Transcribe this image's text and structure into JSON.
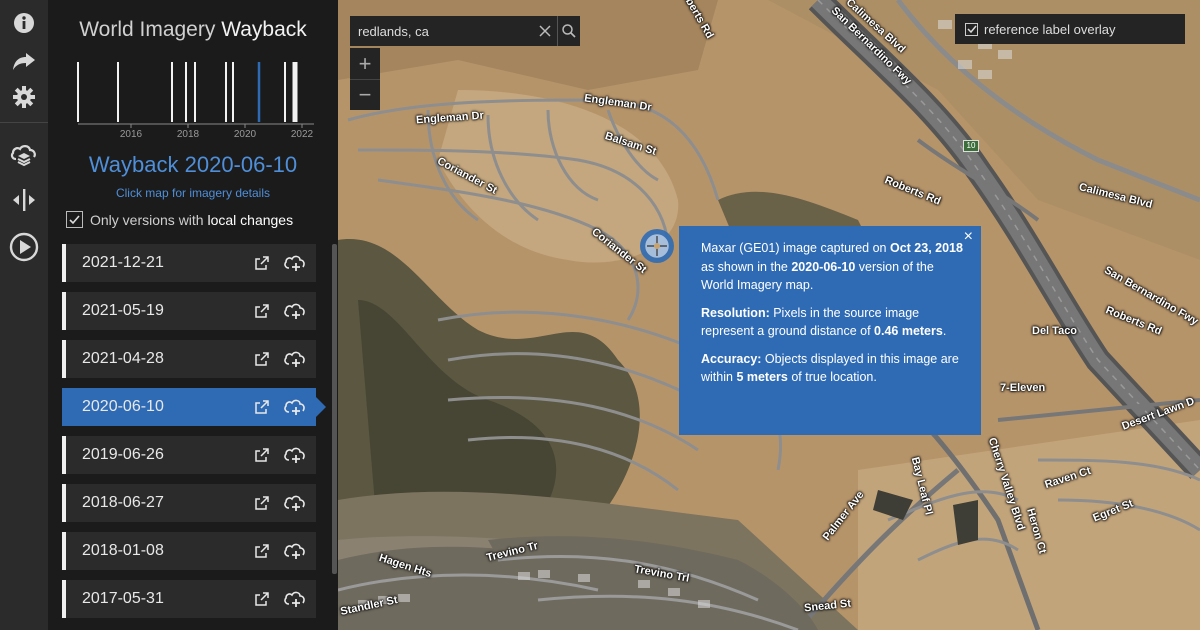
{
  "rail": {
    "icons": [
      "info-icon",
      "share-icon",
      "settings-icon",
      "layers-sync-icon",
      "swipe-icon",
      "play-icon"
    ]
  },
  "panel": {
    "title_plain": "World Imagery ",
    "title_bold": "Wayback",
    "timeline": {
      "tick_labels": [
        "2016",
        "2018",
        "2020",
        "2022"
      ],
      "selected_release": "2020-06-10"
    },
    "wayback_label": "Wayback 2020-06-10",
    "click_hint": "Click map for imagery details",
    "local_changes": {
      "checked": true,
      "label_plain": "Only versions with ",
      "label_bold": "local changes"
    },
    "releases": [
      {
        "date": "2021-12-21",
        "active": false
      },
      {
        "date": "2021-05-19",
        "active": false
      },
      {
        "date": "2021-04-28",
        "active": false
      },
      {
        "date": "2020-06-10",
        "active": true
      },
      {
        "date": "2019-06-26",
        "active": false
      },
      {
        "date": "2018-06-27",
        "active": false
      },
      {
        "date": "2018-01-08",
        "active": false
      },
      {
        "date": "2017-05-31",
        "active": false
      }
    ],
    "accent_color": "#2f6bb5"
  },
  "map": {
    "search": {
      "value": "redlands, ca",
      "clear_icon": "close-icon",
      "search_icon": "search-icon"
    },
    "zoom": {
      "in": "+",
      "out": "−"
    },
    "label_overlay": {
      "checked": true,
      "label": "reference label overlay"
    },
    "road_labels": {
      "engleman_dr_1": "Engleman Dr",
      "engleman_dr_2": "Engleman Dr",
      "balsam_st": "Balsam St",
      "coriander_st_1": "Coriander St",
      "coriander_st_2": "Coriander St",
      "calimesa_blvd_1": "Calimesa Blvd",
      "calimesa_blvd_2": "Calimesa Blvd",
      "san_bernardino_fwy_1": "San Bernardino Fwy",
      "san_bernardino_fwy_2": "San Bernardino Fwy",
      "roberts_rd_1": "Roberts Rd",
      "roberts_rd_2": "Roberts Rd",
      "roberts_rd_3": "Roberts Rd",
      "del_taco": "Del Taco",
      "seven_eleven": "7-Eleven",
      "desert_lawn": "Desert Lawn D",
      "cherry_valley": "Cherry Valley Blvd",
      "raven_ct": "Raven Ct",
      "egret_st": "Egret St",
      "heron_ct": "Heron Ct",
      "bay_leaf_pl": "Bay Leaf Pl",
      "palmer_ave": "Palmer Ave",
      "hagen_hts": "Hagen Hts",
      "trevino_tr": "Trevino Tr",
      "trevino_trl": "Trevino Trl",
      "snead_st": "Snead St",
      "chandler_st": "Standler St",
      "shield": "10"
    },
    "popup": {
      "line1_a": "Maxar (GE01) image captured on ",
      "line1_date": "Oct 23, 2018",
      "line1_b": " as shown in the ",
      "line1_release": "2020-06-10",
      "line1_c": " version of the World Imagery map.",
      "resolution_label": "Resolution:",
      "resolution_text": " Pixels in the source image represent a ground distance of ",
      "resolution_value": "0.46 meters",
      "resolution_end": ".",
      "accuracy_label": "Accuracy:",
      "accuracy_text": " Objects displayed in this image are within ",
      "accuracy_value": "5 meters",
      "accuracy_end": " of true location.",
      "close": "×"
    }
  }
}
